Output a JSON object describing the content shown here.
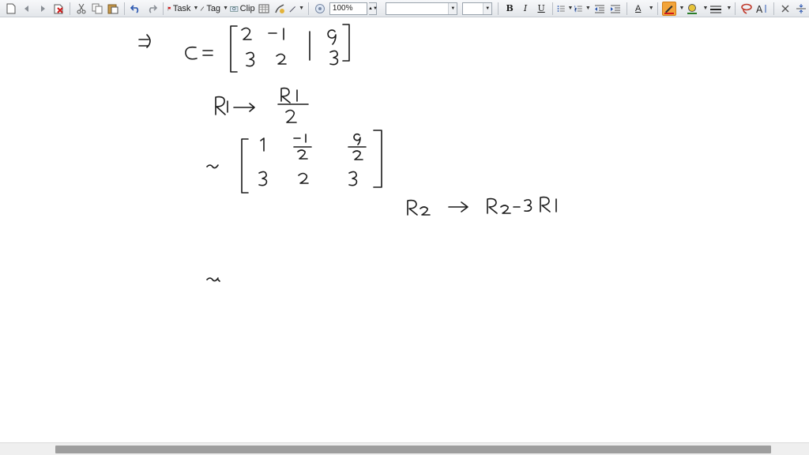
{
  "toolbar": {
    "task_label": "Task",
    "tag_label": "Tag",
    "clip_label": "Clip",
    "zoom_value": "100%",
    "font_name": "",
    "font_size": "",
    "bold_label": "B",
    "italic_label": "I",
    "underline_label": "U",
    "text_color_label": "A",
    "highlight_color": "#f2a43a",
    "text_color": "#d11a1a",
    "fill_color": "#2a7d2a"
  },
  "icons": [
    "new-page-icon",
    "back-icon",
    "forward-icon",
    "delete-icon",
    "cut-icon",
    "copy-icon",
    "paste-icon",
    "undo-icon",
    "redo-icon",
    "task-flag-icon",
    "tag-icon",
    "clip-icon",
    "table-icon",
    "insert-icon",
    "pen-icon",
    "zoom-icon",
    "bullets-icon",
    "numbering-icon",
    "outdent-icon",
    "indent-icon",
    "highlighter-icon",
    "fill-color-icon",
    "line-style-icon",
    "lasso-icon",
    "text-size-icon",
    "erase-icon",
    "insert-space-icon"
  ],
  "canvas": {
    "background": "#ffffff",
    "ink_color": "#1a1a1a"
  },
  "scrollbar": {
    "thumb_color": "#9e9e9e"
  }
}
